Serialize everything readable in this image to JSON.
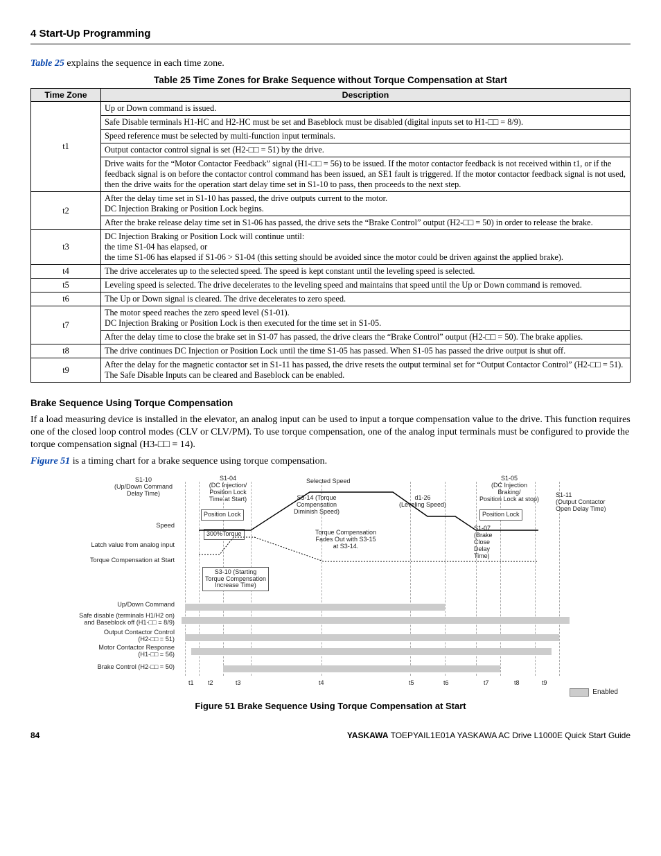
{
  "header": {
    "section": "4  Start-Up Programming"
  },
  "intro1_pre": "Table 25",
  "intro1_post": " explains the sequence in each time zone.",
  "tableTitle": "Table 25  Time Zones for Brake Sequence without Torque Compensation at Start",
  "th": {
    "zone": "Time Zone",
    "desc": "Description"
  },
  "rows": {
    "t1": {
      "zone": "t1",
      "d1": "Up or Down command is issued.",
      "d2": "Safe Disable terminals H1-HC and H2-HC must be set and Baseblock must be disabled (digital inputs set to H1-□□ = 8/9).",
      "d3": "Speed reference must be selected by multi-function input terminals.",
      "d4": "Output contactor control signal is set (H2-□□ = 51) by the drive.",
      "d5": "Drive waits for the “Motor Contactor Feedback” signal (H1-□□ = 56) to be issued. If the motor contactor feedback is not received within t1, or if the feedback signal is on before the contactor control command has been issued, an SE1 fault is triggered. If the motor contactor feedback signal is not used, then the drive waits for the operation start delay time set in S1-10 to pass, then proceeds to the next step."
    },
    "t2": {
      "zone": "t2",
      "d1": "After the delay time set in S1-10 has passed, the drive outputs current to the motor.\nDC Injection Braking or Position Lock begins.",
      "d2": "After the brake release delay time set in S1-06 has passed, the drive sets the “Brake Control” output (H2-□□ = 50) in order to release the brake."
    },
    "t3": {
      "zone": "t3",
      "d": "DC Injection Braking or Position Lock will continue until:\nthe time S1-04 has elapsed, or\nthe time S1-06 has elapsed if S1-06 > S1-04 (this setting should be avoided since the motor could be driven against the applied brake)."
    },
    "t4": {
      "zone": "t4",
      "d": "The drive accelerates up to the selected speed. The speed is kept constant until the leveling speed is selected."
    },
    "t5": {
      "zone": "t5",
      "d": "Leveling speed is selected. The drive decelerates to the leveling speed and maintains that speed until the Up or Down command is removed."
    },
    "t6": {
      "zone": "t6",
      "d": "The Up or Down signal is cleared. The drive decelerates to zero speed."
    },
    "t7": {
      "zone": "t7",
      "d1": "The motor speed reaches the zero speed level (S1-01).\nDC Injection Braking or Position Lock is then executed for the time set in S1-05.",
      "d2": "After the delay time to close the brake set in S1-07 has passed, the drive clears the “Brake Control” output (H2-□□ = 50). The brake applies."
    },
    "t8": {
      "zone": "t8",
      "d": "The drive continues DC Injection or Position Lock until the time S1-05 has passed. When S1-05 has passed the drive output is shut off."
    },
    "t9": {
      "zone": "t9",
      "d": "After the delay for the magnetic contactor set in S1-11 has passed, the drive resets the output terminal set for “Output Contactor Control” (H2-□□ = 51).\nThe Safe Disable Inputs can be cleared and Baseblock can be enabled."
    }
  },
  "subheading": "Brake Sequence Using Torque Compensation",
  "para1": "If a load measuring device is installed in the elevator, an analog input can be used to input a torque compensation value to the drive. This function requires one of the closed loop control modes (CLV or CLV/PM). To use torque compensation, one of the analog input terminals must be configured to provide the torque compensation signal (H3-□□ = 14).",
  "para2_pre": "Figure 51",
  "para2_post": " is a timing chart for a brake sequence using torque compensation.",
  "diagram": {
    "s110": "S1-10\n(Up/Down Command\nDelay Time)",
    "s104": "S1-04\n(DC Injection/\nPosition Lock\nTime at Start)",
    "poslock1": "Position Lock",
    "selspeed": "Selected Speed",
    "torque300": "300%Torque",
    "s314box": "S3-14 (Torque\nCompensation\nDiminish Speed)",
    "tcfades": "Torque Compensation\nFades Out with S3-15\nat S3-14.",
    "s310box": "S3-10 (Starting\nTorque Compensation\nIncrease Time)",
    "d126": "d1-26\n(Leveling Speed)",
    "s105": "S1-05\n(DC Injection\nBraking/\nPosition Lock at stop)",
    "poslock2": "Position Lock",
    "s107": "S1-07\n(Brake\nClose\nDelay\nTime)",
    "s111": "S1-11\n(Output Contactor\nOpen Delay Time)",
    "left_speed": "Speed",
    "left_latch": "Latch value from analog input",
    "left_tcs": "Torque Compensation at Start",
    "left_updown": "Up/Down Command",
    "left_safe": "Safe disable (terminals H1/H2 on)\nand Baseblock off (H1-□□ = 8/9)",
    "left_occ": "Output Contactor Control\n(H2-□□ = 51)",
    "left_mcr": "Motor Contactor Response\n(H1-□□ = 56)",
    "left_bc": "Brake Control (H2-□□ = 50)",
    "ticks": {
      "t1": "t1",
      "t2": "t2",
      "t3": "t3",
      "t4": "t4",
      "t5": "t5",
      "t6": "t6",
      "t7": "t7",
      "t8": "t8",
      "t9": "t9"
    },
    "enabled": "Enabled"
  },
  "figCaption": "Figure 51  Brake Sequence Using Torque Compensation at Start",
  "footer": {
    "page": "84",
    "doc_brand": "YASKAWA",
    "doc_rest": " TOEPYAIL1E01A YASKAWA AC Drive L1000E Quick Start Guide"
  }
}
